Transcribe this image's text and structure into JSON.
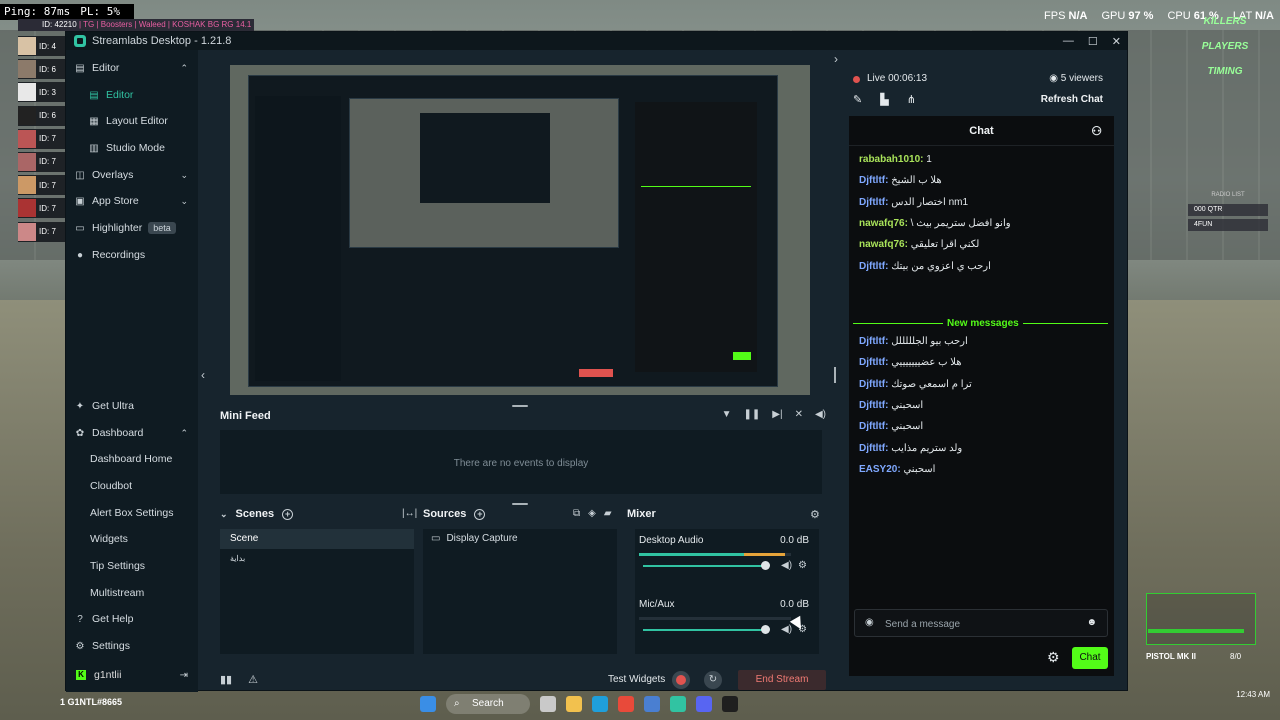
{
  "game": {
    "ping": "Ping: 87ms",
    "pl": "PL: 5%",
    "killfeed_id": "ID: 42210",
    "killfeed_text": "| TG | Boosters | Waleed | KOSHAK BG RG 14.1",
    "player_rows": [
      "ID: 4",
      "ID: 6",
      "ID: 3",
      "ID: 6",
      "ID: 7",
      "ID: 7",
      "ID: 7",
      "ID: 7",
      "ID: 7"
    ],
    "fps_label": "FPS",
    "fps_value": "N/A",
    "gpu_label": "GPU",
    "gpu_value": "97 %",
    "cpu_label": "CPU",
    "cpu_value": "61 %",
    "lat_label": "LAT",
    "lat_value": "N/A",
    "right_hud": [
      "KILLERS",
      "PLAYERS",
      "TIMING"
    ],
    "radio_title": "RADIO LIST",
    "radio_rows": [
      "000 QTR",
      "4FUN"
    ],
    "weapon_name": "PISTOL MK II",
    "weapon_ammo": "8/0",
    "player_name": "1 G1NTL#8665",
    "tray_time": "12:43 AM"
  },
  "taskbar": {
    "search_label": "Search"
  },
  "window": {
    "title": "Streamlabs Desktop - 1.21.8",
    "controls": {
      "minimize": "—",
      "maximize": "☐",
      "close": "✕"
    }
  },
  "sidebar": {
    "editor": "Editor",
    "editor_sub": [
      "Editor",
      "Layout Editor",
      "Studio Mode"
    ],
    "overlays": "Overlays",
    "app_store": "App Store",
    "highlighter": "Highlighter",
    "beta": "beta",
    "recordings": "Recordings",
    "get_ultra": "Get Ultra",
    "dashboard": "Dashboard",
    "dashboard_sub": [
      "Dashboard Home",
      "Cloudbot",
      "Alert Box Settings",
      "Widgets",
      "Tip Settings",
      "Multistream"
    ],
    "get_help": "Get Help",
    "settings": "Settings",
    "user": "g1ntlii"
  },
  "minifeed": {
    "title": "Mini Feed",
    "empty": "There are no events to display"
  },
  "scenes": {
    "title": "Scenes",
    "items": [
      "Scene",
      "بداية"
    ]
  },
  "sources": {
    "title": "Sources",
    "items": [
      "Display Capture"
    ]
  },
  "mixer": {
    "title": "Mixer",
    "channels": [
      {
        "name": "Desktop Audio",
        "db": "0.0 dB",
        "level": 0.96,
        "volume": 1.0
      },
      {
        "name": "Mic/Aux",
        "db": "0.0 dB",
        "level": 0.0,
        "volume": 1.0
      }
    ]
  },
  "bottom": {
    "test_widgets": "Test Widgets",
    "end_stream": "End Stream"
  },
  "stream": {
    "live": "Live 00:06:13",
    "viewers": "5 viewers",
    "refresh_chat": "Refresh Chat"
  },
  "chat": {
    "title": "Chat",
    "new_messages": "New messages",
    "placeholder": "Send a message",
    "send": "Chat",
    "messages_old": [
      {
        "user": "rababah1010:",
        "text": " 1",
        "color": "#a9e35a"
      },
      {
        "user": "Djftltf:",
        "text": " هلا ب الشيخ",
        "color": "#7fa8ff"
      },
      {
        "user": "Djftltf:",
        "text": " اختصار الدس nm1",
        "color": "#7fa8ff"
      },
      {
        "user": "nawafq76:",
        "text": " \\ وانو افضل ستريمر بيث",
        "color": "#a9e35a"
      },
      {
        "user": "nawafq76:",
        "text": " لكني اقرا تعليقي",
        "color": "#a9e35a"
      },
      {
        "user": "Djftltf:",
        "text": " ارحب ي اعزوي من بيتك",
        "color": "#7fa8ff"
      }
    ],
    "messages_new": [
      {
        "user": "Djftltf:",
        "text": " ارحب بيو الجلللللل",
        "color": "#7fa8ff"
      },
      {
        "user": "Djftltf:",
        "text": " هلا ب عضيييييييي",
        "color": "#7fa8ff"
      },
      {
        "user": "Djftltf:",
        "text": " ترا م اسمعي صوتك",
        "color": "#7fa8ff"
      },
      {
        "user": "Djftltf:",
        "text": " اسحبني",
        "color": "#7fa8ff"
      },
      {
        "user": "Djftltf:",
        "text": " اسحبني",
        "color": "#7fa8ff"
      },
      {
        "user": "Djftltf:",
        "text": " ولد ستريم مذايب",
        "color": "#7fa8ff"
      },
      {
        "user": "EASY20:",
        "text": " اسحبني",
        "color": "#7fa8ff"
      }
    ]
  },
  "colors": {
    "accent": "#31c3a2",
    "kick_green": "#53fc18",
    "live_red": "#e0534f"
  }
}
